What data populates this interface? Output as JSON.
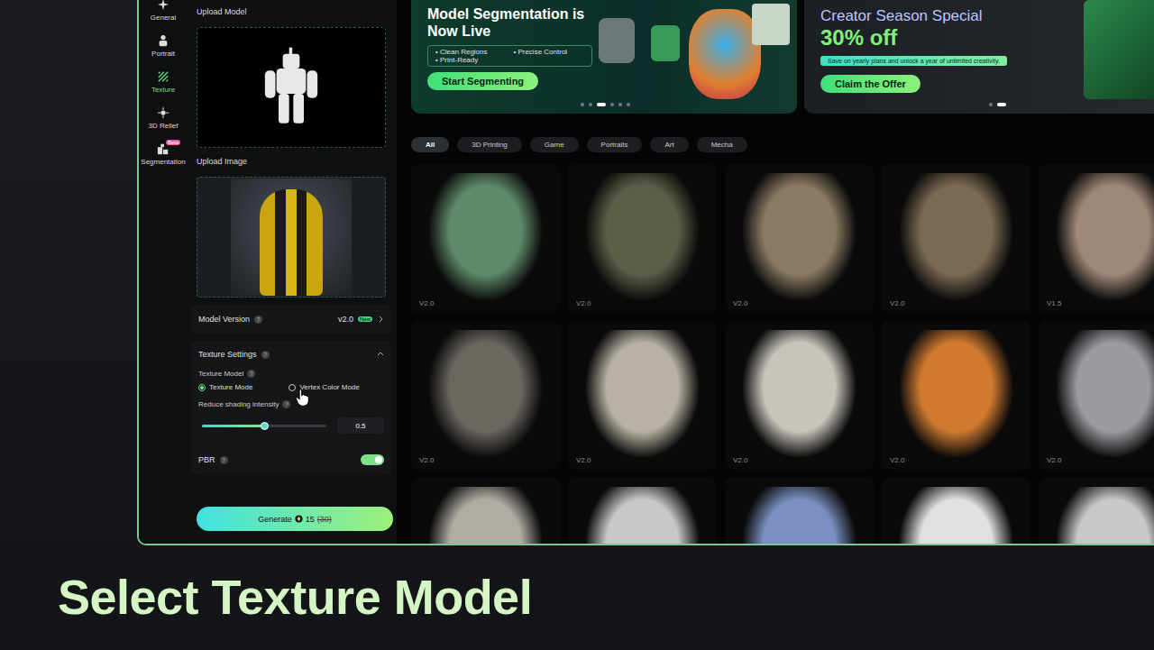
{
  "sidebar": {
    "items": [
      {
        "label": "General",
        "selected": false,
        "badge": ""
      },
      {
        "label": "Portrait",
        "selected": false,
        "badge": ""
      },
      {
        "label": "Texture",
        "selected": true,
        "badge": ""
      },
      {
        "label": "3D Relief",
        "selected": false,
        "badge": ""
      },
      {
        "label": "Segmentation",
        "selected": false,
        "badge": "Beta"
      }
    ]
  },
  "help": "?",
  "panel": {
    "upload_model": {
      "label": "Upload Model"
    },
    "upload_image": {
      "label": "Upload Image"
    },
    "model_version": {
      "label": "Model Version",
      "value": "v2.0",
      "badge": "New"
    },
    "texture_settings": {
      "title": "Texture Settings",
      "expanded": true,
      "texture_model": {
        "label": "Texture Model",
        "options": [
          {
            "label": "Texture Mode",
            "selected": true
          },
          {
            "label": "Vertex Color Mode",
            "selected": false
          }
        ]
      },
      "shading": {
        "label": "Reduce shading intensity",
        "level": 0.5,
        "reading": "0.5"
      },
      "pbr": {
        "label": "PBR",
        "on": true
      }
    },
    "generate": {
      "label": "Generate",
      "cost": "15",
      "original_cost": "(30)"
    }
  },
  "banners": [
    {
      "title": "Model Segmentation is Now Live",
      "bullets": [
        "• Clean Regions",
        "• Precise Control",
        "• Print-Ready"
      ],
      "button": "Start Segmenting",
      "dots": [
        false,
        false,
        true,
        false,
        false,
        false
      ]
    },
    {
      "title": "Creator Season Special",
      "headline": "30% off",
      "subtitle": "Save on yearly plans and unlock a year of unlimited creativity.",
      "button": "Claim the Offer",
      "dots": [
        false,
        true
      ]
    }
  ],
  "filters": [
    {
      "label": "All",
      "selected": true
    },
    {
      "label": "3D Printing",
      "selected": false
    },
    {
      "label": "Game",
      "selected": false
    },
    {
      "label": "Portraits",
      "selected": false
    },
    {
      "label": "Art",
      "selected": false
    },
    {
      "label": "Mecha",
      "selected": false
    }
  ],
  "cards": [
    {
      "version": "V2.0",
      "color": "#5f8a6a"
    },
    {
      "version": "V2.0",
      "color": "#5c5f48"
    },
    {
      "version": "V2.0",
      "color": "#8a7a62"
    },
    {
      "version": "V2.0",
      "color": "#7a6a52"
    },
    {
      "version": "V1.5",
      "color": "#a08878"
    },
    {
      "version": "V2.0",
      "color": "#6a6660"
    },
    {
      "version": "V2.0",
      "color": "#b8b2a4"
    },
    {
      "version": "V2.0",
      "color": "#c8c4bc"
    },
    {
      "version": "V2.0",
      "color": "#d07a30"
    },
    {
      "version": "V2.0",
      "color": "#9a9ca0"
    },
    {
      "color": "#b0aca4"
    },
    {
      "color": "#c8c8c8"
    },
    {
      "color": "#7a90c0"
    },
    {
      "color": "#e0e0e0"
    },
    {
      "color": "#c8c8c8"
    }
  ],
  "caption": "Select Texture Model"
}
